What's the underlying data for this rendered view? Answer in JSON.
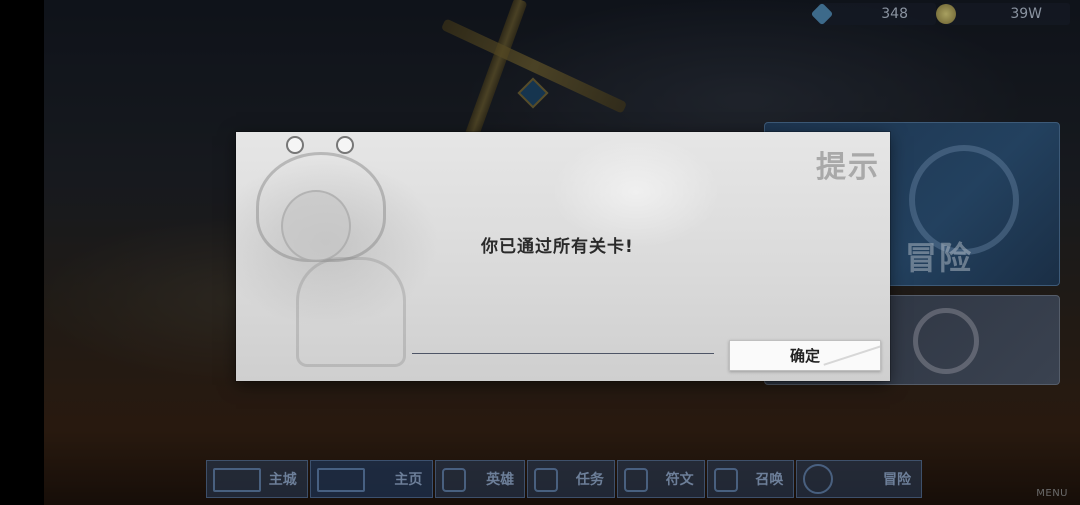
{
  "currency": {
    "gems": "348",
    "gold": "39W",
    "gem_icon": "diamond-icon",
    "gold_icon": "coin-icon"
  },
  "right_panel": {
    "adventure_label": "冒险"
  },
  "bottom_nav": {
    "items": [
      {
        "label": "主城",
        "icon": "castle-icon"
      },
      {
        "label": "主页",
        "icon": "home-gate-icon"
      },
      {
        "label": "英雄",
        "icon": "hero-icon"
      },
      {
        "label": "任务",
        "icon": "quest-icon"
      },
      {
        "label": "符文",
        "icon": "rune-icon"
      },
      {
        "label": "召唤",
        "icon": "summon-icon"
      },
      {
        "label": "冒险",
        "icon": "adventure-gear-icon"
      }
    ]
  },
  "menu_label": "MENU",
  "dialog": {
    "title": "提示",
    "message": "你已通过所有关卡!",
    "confirm_label": "确定"
  },
  "colors": {
    "dialog_bg": "#dcdcdc",
    "nav_text": "#6d7f99",
    "accent_blue": "#23415f"
  }
}
